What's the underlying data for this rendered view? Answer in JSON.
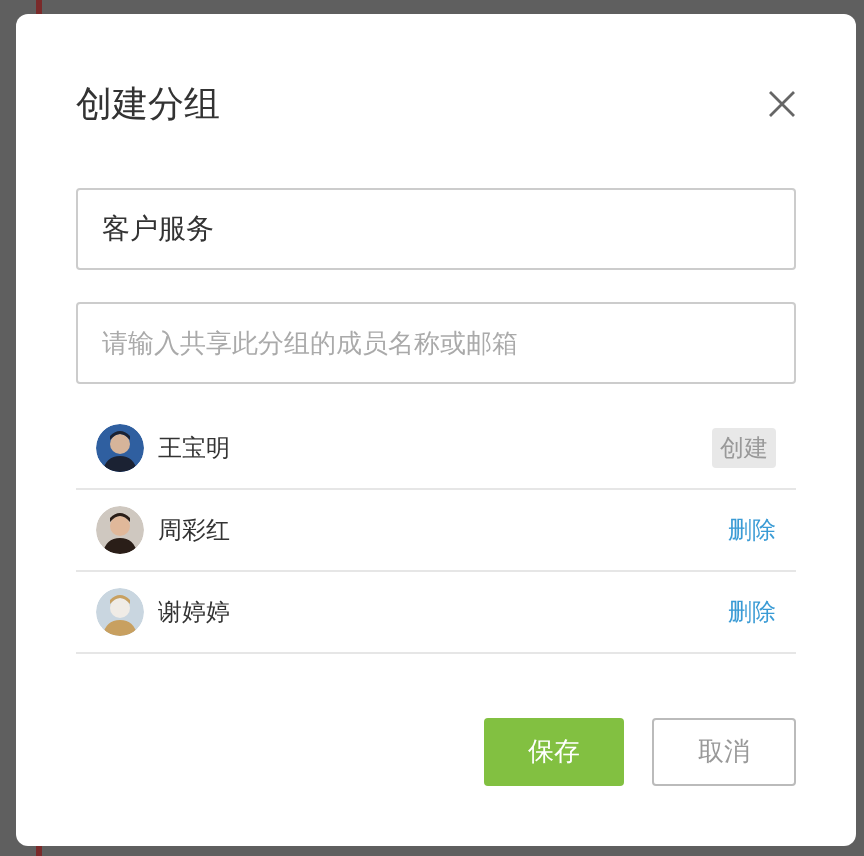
{
  "dialog": {
    "title": "创建分组",
    "group_name": {
      "value": "客户服务"
    },
    "member_search": {
      "placeholder": "请输入共享此分组的成员名称或邮箱"
    },
    "members": [
      {
        "name": "王宝明",
        "action": {
          "kind": "create",
          "label": "创建"
        }
      },
      {
        "name": "周彩红",
        "action": {
          "kind": "delete",
          "label": "删除"
        }
      },
      {
        "name": "谢婷婷",
        "action": {
          "kind": "delete",
          "label": "删除"
        }
      }
    ],
    "buttons": [
      {
        "kind": "primary",
        "label": "保存"
      },
      {
        "kind": "secondary",
        "label": "取消"
      }
    ]
  }
}
